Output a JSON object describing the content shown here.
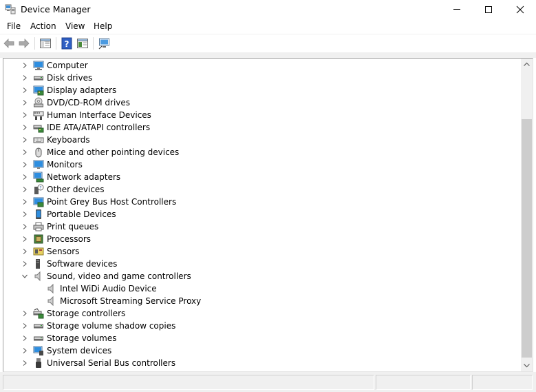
{
  "window": {
    "title": "Device Manager"
  },
  "menu": {
    "file": "File",
    "action": "Action",
    "view": "View",
    "help": "Help"
  },
  "tree": {
    "items": [
      {
        "label": "Computer",
        "icon": "computer-icon"
      },
      {
        "label": "Disk drives",
        "icon": "disk-drive-icon"
      },
      {
        "label": "Display adapters",
        "icon": "display-adapter-icon"
      },
      {
        "label": "DVD/CD-ROM drives",
        "icon": "dvd-drive-icon"
      },
      {
        "label": "Human Interface Devices",
        "icon": "hid-icon"
      },
      {
        "label": "IDE ATA/ATAPI controllers",
        "icon": "ide-controller-icon"
      },
      {
        "label": "Keyboards",
        "icon": "keyboard-icon"
      },
      {
        "label": "Mice and other pointing devices",
        "icon": "mouse-icon"
      },
      {
        "label": "Monitors",
        "icon": "monitor-icon"
      },
      {
        "label": "Network adapters",
        "icon": "network-adapter-icon"
      },
      {
        "label": "Other devices",
        "icon": "other-devices-icon"
      },
      {
        "label": "Point Grey Bus Host Controllers",
        "icon": "bus-controller-icon"
      },
      {
        "label": "Portable Devices",
        "icon": "portable-device-icon"
      },
      {
        "label": "Print queues",
        "icon": "printer-icon"
      },
      {
        "label": "Processors",
        "icon": "processor-icon"
      },
      {
        "label": "Sensors",
        "icon": "sensor-icon"
      },
      {
        "label": "Software devices",
        "icon": "software-device-icon"
      },
      {
        "label": "Sound, video and game controllers",
        "icon": "speaker-icon",
        "expanded": true
      },
      {
        "label": "Intel WiDi Audio Device",
        "icon": "speaker-icon",
        "child": true
      },
      {
        "label": "Microsoft Streaming Service Proxy",
        "icon": "speaker-icon",
        "child": true
      },
      {
        "label": "Storage controllers",
        "icon": "storage-controller-icon"
      },
      {
        "label": "Storage volume shadow copies",
        "icon": "disk-drive-icon"
      },
      {
        "label": "Storage volumes",
        "icon": "disk-drive-icon"
      },
      {
        "label": "System devices",
        "icon": "system-device-icon"
      },
      {
        "label": "Universal Serial Bus controllers",
        "icon": "usb-icon"
      }
    ]
  },
  "colors": {
    "selection": "#cce8ff",
    "chevron": "#5a5a5a",
    "monitor_blue": "#1c7fd6"
  }
}
